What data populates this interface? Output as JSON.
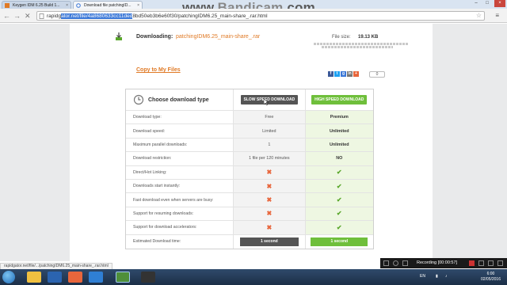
{
  "watermark": {
    "part1": "www.",
    "part2": "Bandicam",
    "part3": ".com"
  },
  "tabs": [
    {
      "label": "Keygen IDM 6.25 Build 1..."
    },
    {
      "label": "Download file patchingID..."
    }
  ],
  "address": {
    "prefix": "rapidg",
    "selected": "ator.net/file/4a8680633cc11ded",
    "suffix": "8bd50eb3b6e60f30/patchingIDM6.25_main-share_.rar.html"
  },
  "download": {
    "label": "Downloading:",
    "filename": "patchingIDM6.25_main-share_.rar",
    "file_size_label": "File size:",
    "file_size_value": "19.13 KB"
  },
  "copy_link": "Copy to My Files",
  "share": {
    "buttons": [
      "f",
      "t",
      "g",
      "in",
      "+"
    ],
    "count": "0"
  },
  "table": {
    "header_title": "Choose download type",
    "slow_button": "SLOW SPEED DOWNLOAD",
    "high_button": "HIGH SPEED DOWNLOAD",
    "rows": [
      {
        "label": "Download type:",
        "slow": "Free",
        "high": "Premium"
      },
      {
        "label": "Download speed:",
        "slow": "Limited",
        "high": "Unlimited"
      },
      {
        "label": "Maximum parallel downloads:",
        "slow": "1",
        "high": "Unlimited"
      },
      {
        "label": "Download restriction:",
        "slow": "1 file per 120 minutes",
        "high": "NO"
      },
      {
        "label": "Direct/Hot Linking:",
        "slow": "✖",
        "high": "✔"
      },
      {
        "label": "Downloads start instantly:",
        "slow": "✖",
        "high": "✔"
      },
      {
        "label": "Fast download even when servers are busy:",
        "slow": "✖",
        "high": "✔"
      },
      {
        "label": "Support for resuming downloads:",
        "slow": "✖",
        "high": "✔"
      },
      {
        "label": "Support for download accelerators:",
        "slow": "✖",
        "high": "✔"
      },
      {
        "label": "Estimated Download time:",
        "slow": "1 second",
        "high": "1 second"
      }
    ]
  },
  "status_bar": "rapidgator.net/file/.../patchingIDM6.25_main-share_.rar.html",
  "recording": {
    "label": "Recording [00:00:57]"
  },
  "taskbar": {
    "lang": "EN",
    "time": "6:00",
    "date": "02/05/2016"
  },
  "colors": {
    "accent_orange": "#e07a26",
    "high_green": "#6fbf3b",
    "slow_gray": "#555555",
    "selection_blue": "#3b78d8"
  }
}
